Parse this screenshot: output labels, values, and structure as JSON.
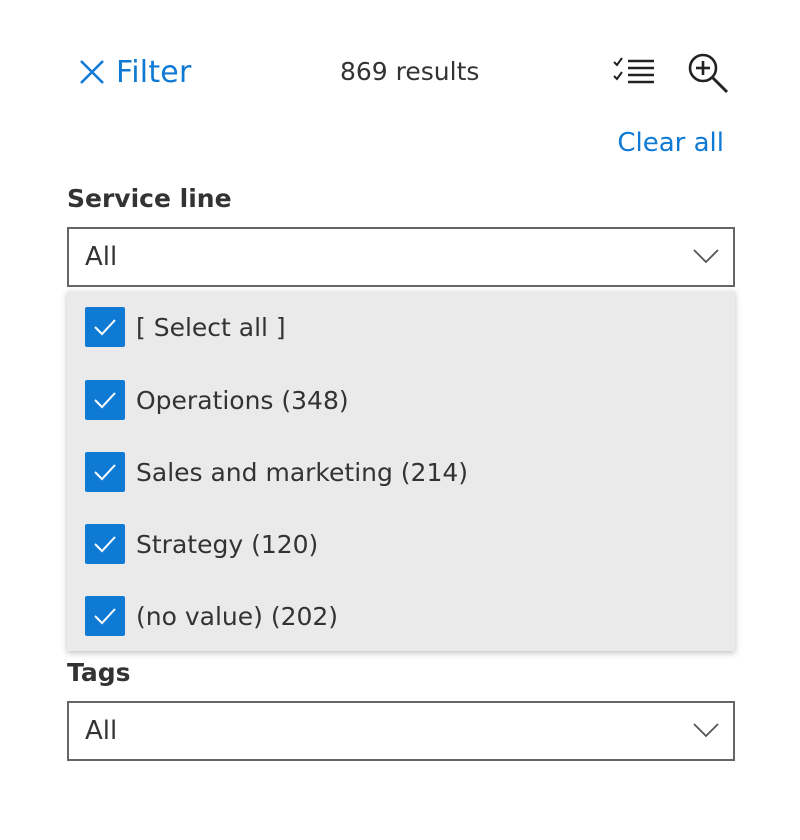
{
  "header": {
    "close_icon": "close-icon",
    "filter_label": "Filter",
    "results_text": "869 results",
    "checklist_icon": "checklist-icon",
    "zoom_icon": "zoom-in-icon"
  },
  "clear_all_label": "Clear all",
  "service_line": {
    "label": "Service line",
    "selected_value": "All",
    "options": [
      {
        "label": "[ Select all ]",
        "checked": true
      },
      {
        "label": "Operations (348)",
        "checked": true
      },
      {
        "label": "Sales and marketing (214)",
        "checked": true
      },
      {
        "label": "Strategy (120)",
        "checked": true
      },
      {
        "label": "(no value) (202)",
        "checked": true
      }
    ]
  },
  "tags": {
    "label": "Tags",
    "selected_value": "All"
  },
  "colors": {
    "accent": "#0f7ad4",
    "text": "#333333",
    "panel_background": "#eaeaea",
    "border": "#666666"
  }
}
